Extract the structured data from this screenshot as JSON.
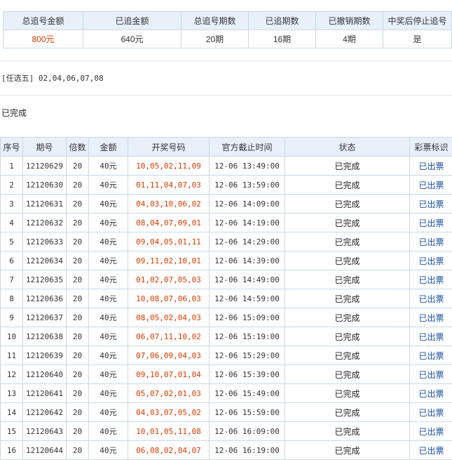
{
  "summary": {
    "headers": [
      "总追号金额",
      "已追金额",
      "总追号期数",
      "已追期数",
      "已撤销期数",
      "中奖后停止追号"
    ],
    "values": [
      "800元",
      "640元",
      "20期",
      "16期",
      "4期",
      "是"
    ]
  },
  "picks": "[任选五] 02,04,06,07,08",
  "status_text": "已完成",
  "detail": {
    "headers": [
      "序号",
      "期号",
      "倍数",
      "金额",
      "开奖号码",
      "官方截止时间",
      "状态",
      "彩票标识"
    ],
    "rows": [
      [
        "1",
        "12120629",
        "20",
        "40元",
        "10,05,02,11,09",
        "12-06 13:49:00",
        "已完成",
        "已出票"
      ],
      [
        "2",
        "12120630",
        "20",
        "40元",
        "01,11,04,07,03",
        "12-06 13:59:00",
        "已完成",
        "已出票"
      ],
      [
        "3",
        "12120631",
        "20",
        "40元",
        "04,03,10,06,02",
        "12-06 14:09:00",
        "已完成",
        "已出票"
      ],
      [
        "4",
        "12120632",
        "20",
        "40元",
        "08,04,07,09,01",
        "12-06 14:19:00",
        "已完成",
        "已出票"
      ],
      [
        "5",
        "12120633",
        "20",
        "40元",
        "09,04,05,01,11",
        "12-06 14:29:00",
        "已完成",
        "已出票"
      ],
      [
        "6",
        "12120634",
        "20",
        "40元",
        "09,11,02,10,01",
        "12-06 14:39:00",
        "已完成",
        "已出票"
      ],
      [
        "7",
        "12120635",
        "20",
        "40元",
        "01,02,07,05,03",
        "12-06 14:49:00",
        "已完成",
        "已出票"
      ],
      [
        "8",
        "12120636",
        "20",
        "40元",
        "10,08,07,06,03",
        "12-06 14:59:00",
        "已完成",
        "已出票"
      ],
      [
        "9",
        "12120637",
        "20",
        "40元",
        "08,05,02,04,03",
        "12-06 15:09:00",
        "已完成",
        "已出票"
      ],
      [
        "10",
        "12120638",
        "20",
        "40元",
        "06,07,11,10,02",
        "12-06 15:19:00",
        "已完成",
        "已出票"
      ],
      [
        "11",
        "12120639",
        "20",
        "40元",
        "07,06,09,04,03",
        "12-06 15:29:00",
        "已完成",
        "已出票"
      ],
      [
        "12",
        "12120640",
        "20",
        "40元",
        "09,10,07,01,04",
        "12-06 15:39:00",
        "已完成",
        "已出票"
      ],
      [
        "13",
        "12120641",
        "20",
        "40元",
        "05,07,02,01,03",
        "12-06 15:49:00",
        "已完成",
        "已出票"
      ],
      [
        "14",
        "12120642",
        "20",
        "40元",
        "04,03,07,05,02",
        "12-06 15:59:00",
        "已完成",
        "已出票"
      ],
      [
        "15",
        "12120643",
        "20",
        "40元",
        "10,01,05,11,08",
        "12-06 16:09:00",
        "已完成",
        "已出票"
      ],
      [
        "16",
        "12120644",
        "20",
        "40元",
        "06,08,02,04,07",
        "12-06 16:19:00",
        "已完成",
        "已出票"
      ]
    ]
  }
}
